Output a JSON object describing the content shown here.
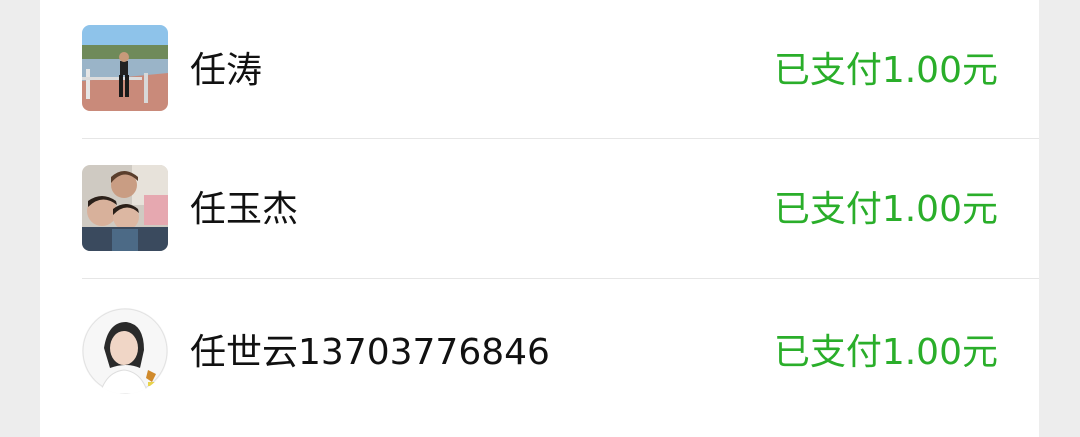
{
  "status_color": "#2aae2a",
  "payments": [
    {
      "name": "任涛",
      "status": "已支付1.00元",
      "avatar": "person-lakeside-photo"
    },
    {
      "name": "任玉杰",
      "status": "已支付1.00元",
      "avatar": "children-photo"
    },
    {
      "name": "任世云13703776846",
      "status": "已支付1.00元",
      "avatar": "woman-portrait-photo"
    }
  ]
}
